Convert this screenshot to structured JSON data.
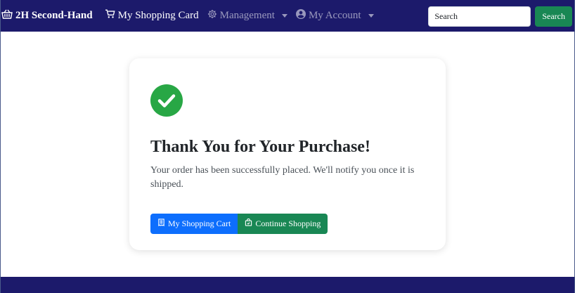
{
  "navbar": {
    "brand": "2H Second-Hand",
    "links": [
      {
        "label": "My Shopping Card",
        "icon": "cart-icon",
        "active": true
      },
      {
        "label": "Management",
        "icon": "gear-icon",
        "dropdown": true
      },
      {
        "label": "My Account",
        "icon": "user-circle-icon",
        "dropdown": true
      }
    ],
    "search": {
      "placeholder": "Search",
      "button_label": "Search"
    }
  },
  "confirmation": {
    "icon": "check-circle-icon",
    "title": "Thank You for Your Purchase!",
    "message": "Your order has been successfully placed. We'll notify you once it is shipped.",
    "buttons": {
      "cart_label": "My Shopping Cart",
      "continue_label": "Continue Shopping"
    }
  },
  "colors": {
    "navbar_bg": "#1c1a6b",
    "success": "#198754",
    "primary": "#0d6efd",
    "check": "#28a745"
  }
}
